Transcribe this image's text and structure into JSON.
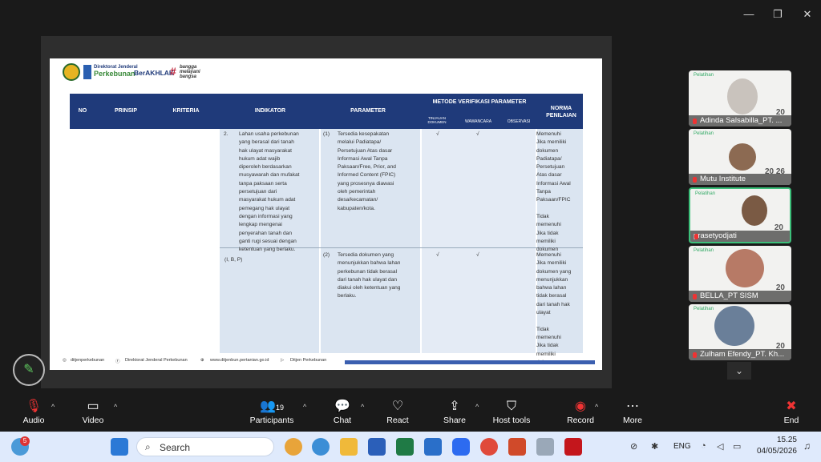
{
  "window": {
    "minimize": "—",
    "restore": "❐",
    "close": "✕"
  },
  "slide": {
    "logos": {
      "ditjen_line1": "Direktorat Jenderal",
      "ditjen_line2": "Perkebunan",
      "berakhlak": "BerAKHLAK",
      "bangga1": "bangga",
      "bangga2": "melayani",
      "bangga3": "bangsa"
    },
    "headers": {
      "no": "NO",
      "prinsip": "PRINSIP",
      "kriteria": "KRITERIA",
      "indikator": "INDIKATOR",
      "parameter": "PARAMETER",
      "metode": "METODE VERIFIKASI PARAMETER",
      "tinjauan": "TINJAUAN DOKUMEN",
      "wawancara": "WAWANCARA",
      "observasi": "OBSERVASI",
      "norma": "NORMA PENILAIAN"
    },
    "row1": {
      "no": "2.",
      "indikator": "Lahan usaha perkebunan\nyang berasal dari tanah\nhak ulayat masyarakat\nhukum adat wajib\ndiperoleh berdasarkan\nmusyawarah dan mufakat\ntanpa paksaan serta\npersetujuan dari\nmasyarakat hukum adat\npemegang hak ulayat\ndengan informasi yang\nlengkap mengenai\npenyerahan tanah dan\nganti rugi sesuai dengan\nketentuan yang berlaku.",
      "pno": "(1)",
      "parameter": "Tersedia kesepakatan\nmelalui Padiatapa/\nPersetujuan Atas dasar\nInformasi Awal Tanpa\nPaksaan/Free, Prior, and\nInformed Content (FPIC)\nyang prosesnya diawasi\noleh pemerintah\ndesa/kecamatan/\nkabupaten/kota.",
      "check1": "√",
      "check2": "√",
      "norma": "Memenuhi\nJika memiliki\ndokumen\nPadiatapa/\nPersetujuan\nAtas dasar\nInformasi Awal\nTanpa\nPaksaan/FPIC\n\nTidak\nmemenuhi\nJika tidak\nmemiliki\ndokumen"
    },
    "row2": {
      "ref": "(I, B, P)",
      "pno": "(2)",
      "parameter": "Tersedia dokumen yang\nmenunjukkan bahwa lahan\nperkebunan tidak berasal\ndari tanah hak ulayat dan\ndiakui oleh ketentuan yang\nberlaku.",
      "check1": "√",
      "check2": "√",
      "norma": "Memenuhi\nJika memiliki\ndokumen yang\nmenunjukkan\nbahwa lahan\ntidak berasal\ndari tanah hak\nulayat\n\nTidak\nmemenuhi\nJika tidak\nmemiliki\ndokumen"
    },
    "footer": {
      "ig": "ditjenperkebunan",
      "fb": "Direktorat Jenderal Perkebunan",
      "web": "www.ditjenbun.pertanian.go.id",
      "yt": "Ditjen Perkebunan"
    }
  },
  "participants": [
    {
      "name": "Adinda Salsabilla_PT. ...",
      "title": "Pelatihan",
      "num": "20"
    },
    {
      "name": "Mutu Institute",
      "title": "Pelatihan",
      "num": "20\n26"
    },
    {
      "name": "prasetyodjati",
      "title": "Pelatihan",
      "num": "20"
    },
    {
      "name": "BELLA_PT SISM",
      "title": "Pelatihan",
      "num": "20"
    },
    {
      "name": "Zulham Efendy_PT. Kh...",
      "title": "Pelatihan",
      "num": "20"
    }
  ],
  "toolbar": {
    "audio": "Audio",
    "video": "Video",
    "participants": "Participants",
    "participants_count": "19",
    "chat": "Chat",
    "react": "React",
    "share": "Share",
    "host_tools": "Host tools",
    "record": "Record",
    "more": "More",
    "end": "End"
  },
  "taskbar": {
    "search": "Search",
    "badge": "5",
    "lang": "ENG",
    "time": "15.25",
    "date": "04/05/2026"
  },
  "colors": {
    "header": "#1f3a7a",
    "cell": "#dbe5f1",
    "active_border": "#3cc07a"
  }
}
